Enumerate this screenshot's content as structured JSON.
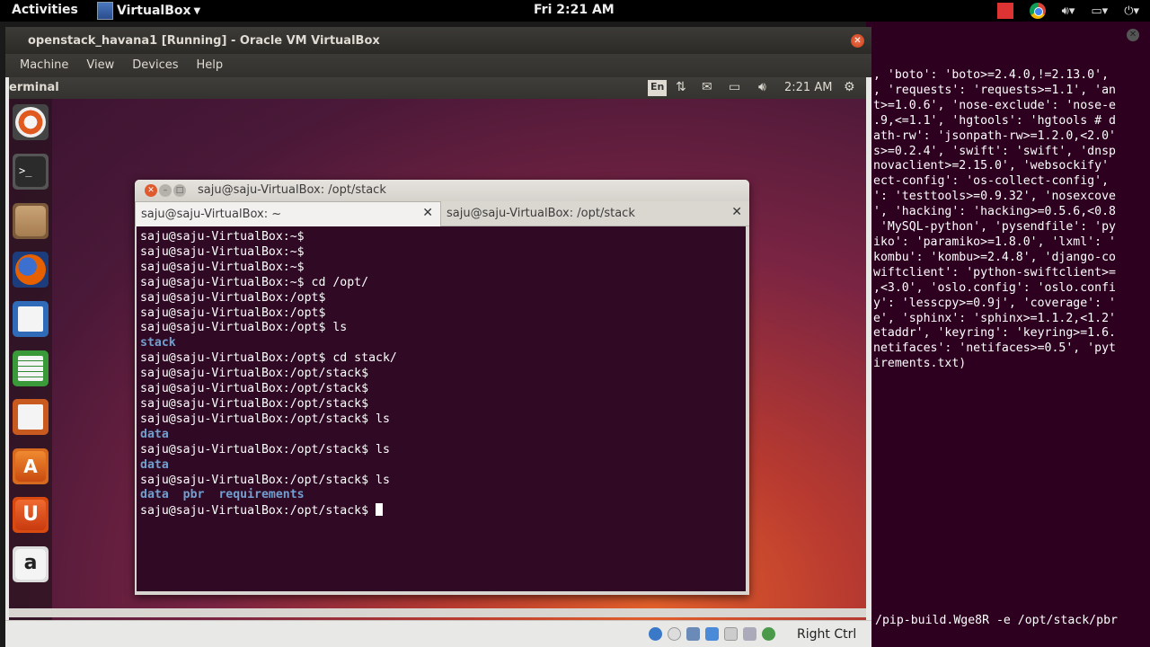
{
  "host_topbar": {
    "activities": "Activities",
    "app_menu": "VirtualBox",
    "clock": "Fri  2:21 AM",
    "tray_icons": [
      "red-square-icon",
      "chrome-icon",
      "volume-icon",
      "battery-icon",
      "power-icon"
    ]
  },
  "vbox": {
    "title": "openstack_havana1 [Running] - Oracle VM VirtualBox",
    "menu": [
      "Machine",
      "View",
      "Devices",
      "Help"
    ],
    "host_key": "Right Ctrl"
  },
  "guest_panel": {
    "app_name": "erminal",
    "keyboard": "En",
    "time": "2:21 AM"
  },
  "launcher_items": [
    {
      "name": "dash-icon"
    },
    {
      "name": "terminal-icon"
    },
    {
      "name": "files-icon"
    },
    {
      "name": "firefox-icon"
    },
    {
      "name": "writer-icon"
    },
    {
      "name": "calc-icon"
    },
    {
      "name": "impress-icon"
    },
    {
      "name": "software-center-icon"
    },
    {
      "name": "ubuntu-one-icon"
    },
    {
      "name": "amazon-icon"
    }
  ],
  "terminal": {
    "title": "saju@saju-VirtualBox: /opt/stack",
    "tabs": [
      {
        "label": "saju@saju-VirtualBox: ~"
      },
      {
        "label": "saju@saju-VirtualBox: /opt/stack"
      }
    ],
    "lines": [
      {
        "t": "saju@saju-VirtualBox:~$"
      },
      {
        "t": "saju@saju-VirtualBox:~$"
      },
      {
        "t": "saju@saju-VirtualBox:~$"
      },
      {
        "t": "saju@saju-VirtualBox:~$ cd /opt/"
      },
      {
        "t": "saju@saju-VirtualBox:/opt$"
      },
      {
        "t": "saju@saju-VirtualBox:/opt$"
      },
      {
        "t": "saju@saju-VirtualBox:/opt$ ls"
      },
      {
        "t": "stack",
        "dir": true
      },
      {
        "t": "saju@saju-VirtualBox:/opt$ cd stack/"
      },
      {
        "t": "saju@saju-VirtualBox:/opt/stack$"
      },
      {
        "t": "saju@saju-VirtualBox:/opt/stack$"
      },
      {
        "t": "saju@saju-VirtualBox:/opt/stack$"
      },
      {
        "t": "saju@saju-VirtualBox:/opt/stack$ ls"
      },
      {
        "t": "data",
        "dir": true
      },
      {
        "t": "saju@saju-VirtualBox:/opt/stack$ ls"
      },
      {
        "t": "data",
        "dir": true
      },
      {
        "t": "saju@saju-VirtualBox:/opt/stack$ ls"
      },
      {
        "t": "data  pbr  requirements",
        "dir": true
      },
      {
        "t": "saju@saju-VirtualBox:/opt/stack$ ",
        "cursor": true
      }
    ]
  },
  "host_terminal": {
    "lines": [
      ", 'boto': 'boto>=2.4.0,!=2.13.0',",
      ", 'requests': 'requests>=1.1', 'an",
      "t>=1.0.6', 'nose-exclude': 'nose-e",
      ".9,<=1.1', 'hgtools': 'hgtools # d",
      "ath-rw': 'jsonpath-rw>=1.2.0,<2.0'",
      "s>=0.2.4', 'swift': 'swift', 'dnsp",
      "novaclient>=2.15.0', 'websockify'",
      "ect-config': 'os-collect-config',",
      "': 'testtools>=0.9.32', 'nosexcove",
      "', 'hacking': 'hacking>=0.5.6,<0.8",
      " 'MySQL-python', 'pysendfile': 'py",
      "iko': 'paramiko>=1.8.0', 'lxml': '",
      "kombu': 'kombu>=2.4.8', 'django-co",
      "wiftclient': 'python-swiftclient>=",
      ",<3.0', 'oslo.config': 'oslo.confi",
      "y': 'lesscpy>=0.9j', 'coverage': '",
      "e', 'sphinx': 'sphinx>=1.1.2,<1.2'",
      "etaddr', 'keyring': 'keyring>=1.6.",
      "netifaces': 'netifaces>=0.5', 'pyt",
      "irements.txt)"
    ],
    "bottom_line": "/pip-build.Wge8R -e /opt/stack/pbr"
  }
}
